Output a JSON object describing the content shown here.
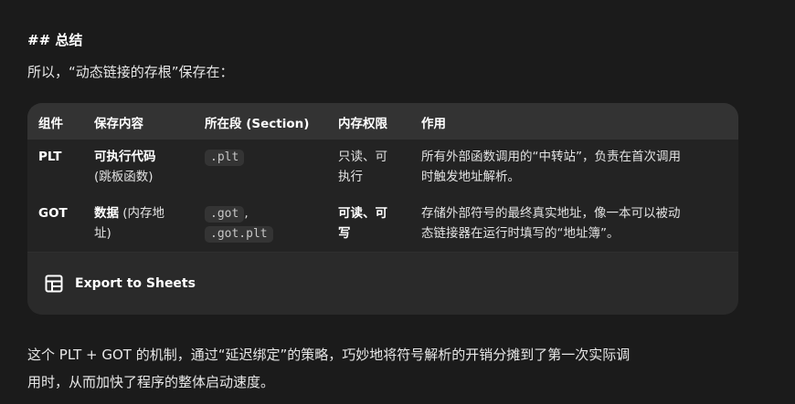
{
  "heading": "## 总结",
  "intro": "所以，“动态链接的存根”保存在：",
  "table": {
    "headers": [
      "组件",
      "保存内容",
      "所在段 (Section)",
      "内存权限",
      "作用"
    ],
    "rows": [
      {
        "component": "PLT",
        "content_bold": "可执行代码",
        "content_rest": "(跳板函数)",
        "sections": [
          ".plt"
        ],
        "perm_line1": "只读、可",
        "perm_line2": "执行",
        "purpose_line1": "所有外部函数调用的“中转站”，负责在首次调用",
        "purpose_line2": "时触发地址解析。"
      },
      {
        "component": "GOT",
        "content_bold": "数据",
        "content_rest": " (内存地",
        "content_line2": "址)",
        "sections": [
          ".got",
          ".got.plt"
        ],
        "section_sep": ",",
        "perm_line1": "可读、可",
        "perm_line2": "写",
        "purpose_line1": "存储外部符号的最终真实地址，像一本可以被动",
        "purpose_line2": "态链接器在运行时填写的“地址簿”。"
      }
    ]
  },
  "export": {
    "label": "Export to Sheets",
    "icon": "table-grid-icon"
  },
  "summary_line1": "这个 PLT + GOT 的机制，通过“延迟绑定”的策略，巧妙地将符号解析的开销分摊到了第一次实际调",
  "summary_line2": "用时，从而加快了程序的整体启动速度。",
  "colors": {
    "background": "#1b1b1b",
    "table_header": "#333333",
    "table_body": "#232323",
    "code_bg": "#343434",
    "text": "#e3e3e3"
  }
}
